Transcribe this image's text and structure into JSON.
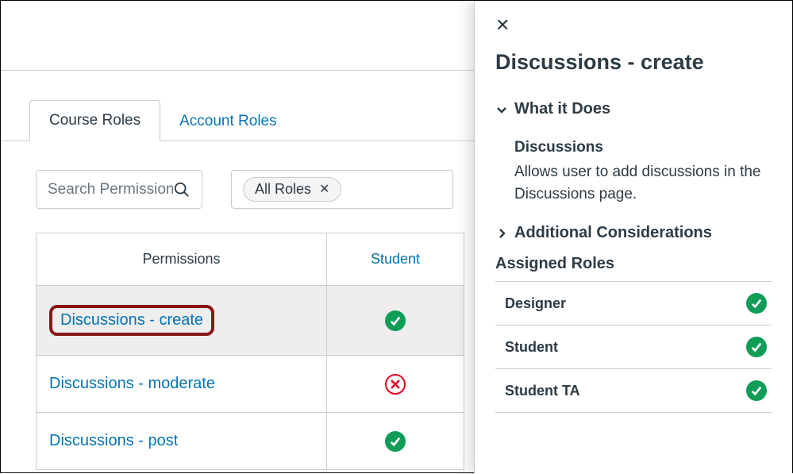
{
  "tabs": {
    "course": "Course Roles",
    "account": "Account Roles"
  },
  "search": {
    "placeholder": "Search Permissions"
  },
  "filter": {
    "chip_label": "All Roles"
  },
  "table": {
    "header_permissions": "Permissions",
    "header_role": "Student",
    "rows": [
      {
        "label": "Discussions - create",
        "status": "allowed",
        "selected": true
      },
      {
        "label": "Discussions - moderate",
        "status": "denied",
        "selected": false
      },
      {
        "label": "Discussions - post",
        "status": "allowed",
        "selected": false
      }
    ]
  },
  "panel": {
    "title": "Discussions - create",
    "what_it_does_label": "What it Does",
    "discussions_heading": "Discussions",
    "description": "Allows user to add discussions in the Discussions page.",
    "additional_label": "Additional Considerations",
    "assigned_label": "Assigned Roles",
    "roles": [
      {
        "name": "Designer",
        "status": "allowed"
      },
      {
        "name": "Student",
        "status": "allowed"
      },
      {
        "name": "Student TA",
        "status": "allowed"
      }
    ]
  }
}
